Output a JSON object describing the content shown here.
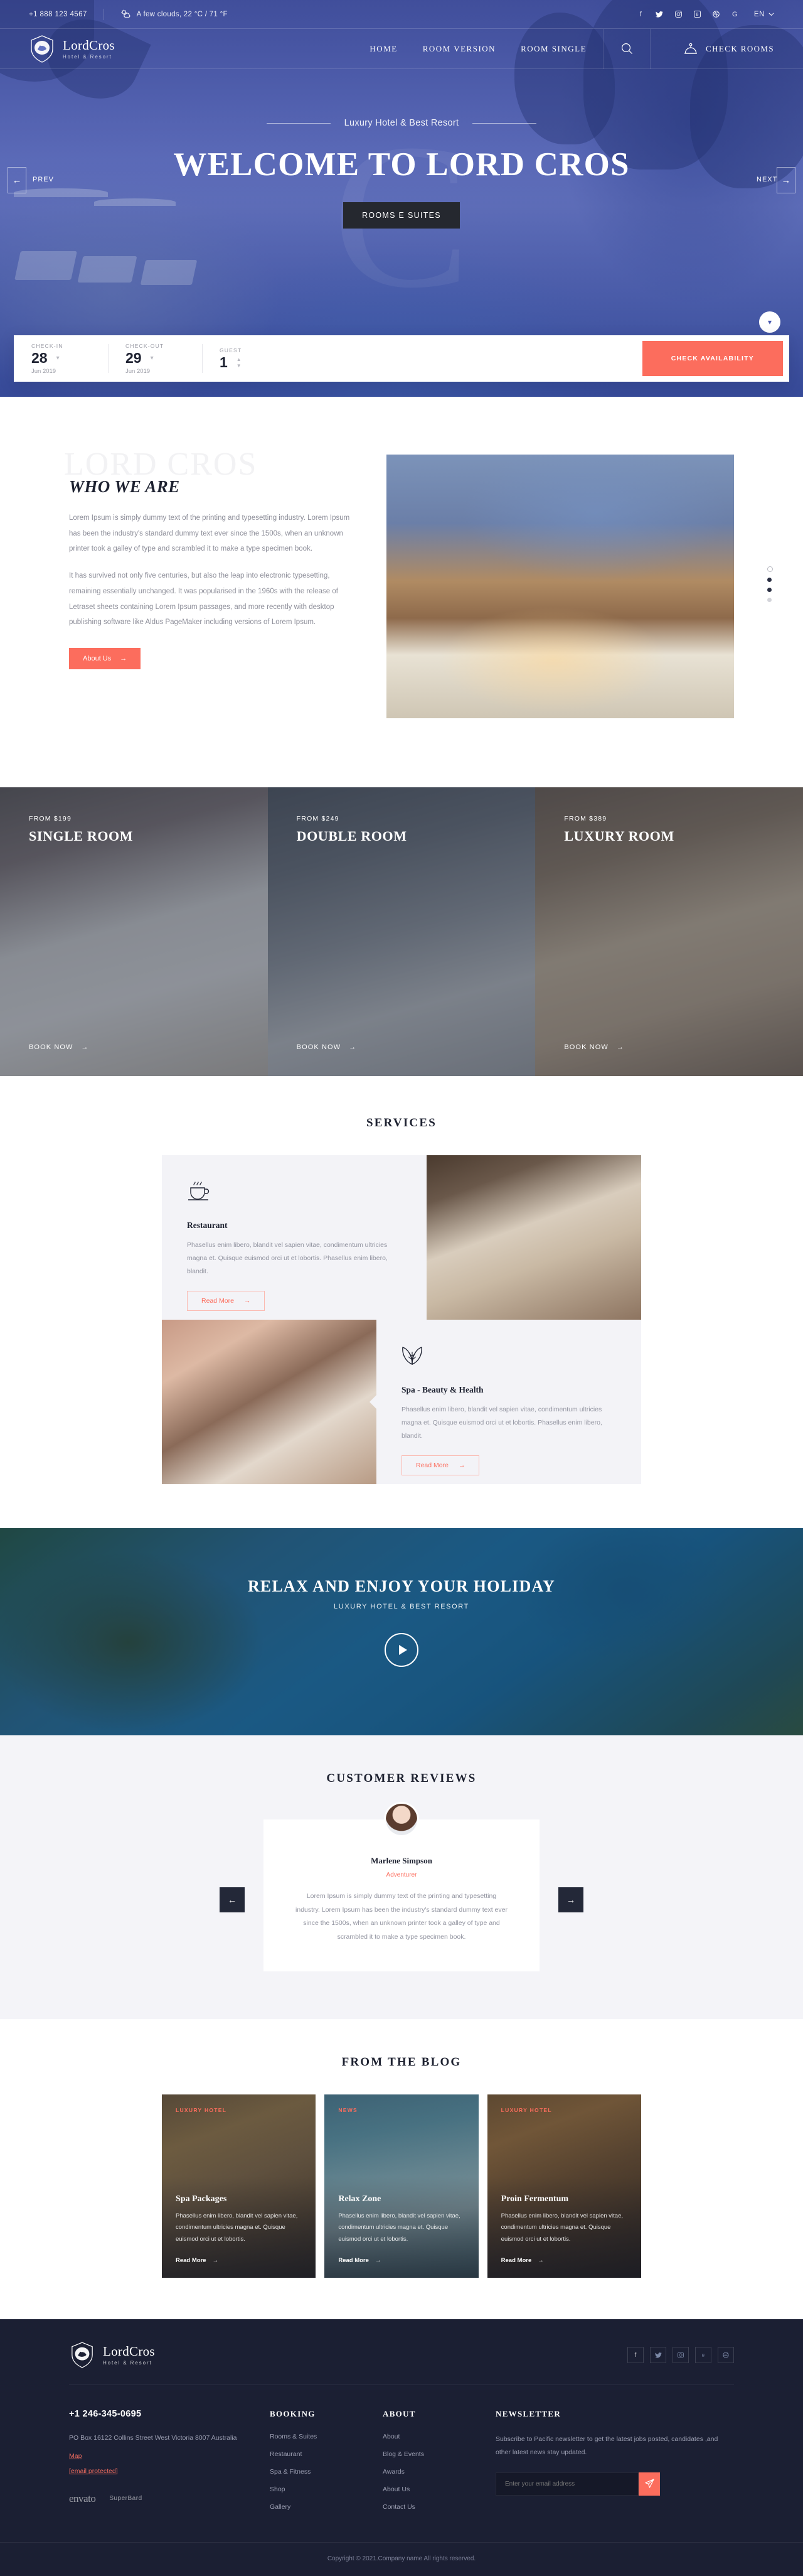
{
  "topbar": {
    "phone": "+1 888 123 4567",
    "weather": "A few clouds, 22 °C / 71 °F",
    "weather_icon": "cloud-sun-icon",
    "socials": [
      {
        "name": "facebook-icon",
        "glyph": "f"
      },
      {
        "name": "twitter-icon",
        "glyph": "ᴛ"
      },
      {
        "name": "instagram-icon",
        "glyph": "◎"
      },
      {
        "name": "behance-icon",
        "glyph": "Ⓑ"
      },
      {
        "name": "dribbble-icon",
        "glyph": "◉"
      },
      {
        "name": "google-icon",
        "glyph": "G"
      }
    ],
    "lang": "EN"
  },
  "brand": {
    "name": "LordCros",
    "tagline": "Hotel & Resort",
    "logo_icon": "lion-crest-icon"
  },
  "nav": {
    "items": [
      {
        "label": "HOME"
      },
      {
        "label": "ROOM VERSION"
      },
      {
        "label": "ROOM SINGLE"
      }
    ],
    "search_icon": "search-icon",
    "bell_icon": "service-bell-icon",
    "check_rooms": "CHECK ROOMS"
  },
  "hero": {
    "kicker": "Luxury Hotel & Best Resort",
    "title": "WELCOME TO LORD CROS",
    "button": "ROOMS E SUITES",
    "prev_label": "PREV",
    "next_label": "NEXT",
    "scroll_label": "Scroll Down",
    "watermark": "C"
  },
  "booking": {
    "checkin": {
      "label": "CHECK-IN",
      "day": "28",
      "month": "Jun 2019"
    },
    "checkout": {
      "label": "CHECK-OUT",
      "day": "29",
      "month": "Jun 2019"
    },
    "guest": {
      "label": "GUEST",
      "count": "1"
    },
    "submit": "CHECK AVAILABILITY"
  },
  "about": {
    "ghost": "LORD CROS",
    "heading": "WHO WE ARE",
    "p1": "Lorem Ipsum is simply dummy text of the printing and typesetting industry. Lorem Ipsum has been the industry's standard dummy text ever since the 1500s, when an unknown printer took a galley of type and scrambled it to make a type specimen book.",
    "p2": "It has survived not only five centuries, but also the leap into electronic typesetting, remaining essentially unchanged. It was popularised in the 1960s with the release of Letraset sheets containing Lorem Ipsum passages, and more recently with desktop publishing software like Aldus PageMaker including versions of Lorem Ipsum.",
    "button": "About Us"
  },
  "rooms": [
    {
      "from": "FROM $199",
      "name": "SINGLE ROOM",
      "cta": "BOOK NOW"
    },
    {
      "from": "FROM $249",
      "name": "DOUBLE ROOM",
      "cta": "BOOK NOW"
    },
    {
      "from": "FROM $389",
      "name": "LUXURY ROOM",
      "cta": "BOOK NOW"
    }
  ],
  "services": {
    "title": "SERVICES",
    "cards": [
      {
        "icon": "coffee-cup-icon",
        "heading": "Restaurant",
        "text": "Phasellus enim libero, blandit vel sapien vitae, condimentum ultricies magna et. Quisque euismod orci ut et lobortis. Phasellus enim libero, blandit.",
        "cta": "Read More"
      },
      {
        "icon": "leaves-icon",
        "heading": "Spa - Beauty & Health",
        "text": "Phasellus enim libero, blandit vel sapien vitae, condimentum ultricies magna et. Quisque euismod orci ut et lobortis. Phasellus enim libero, blandit.",
        "cta": "Read More"
      }
    ]
  },
  "relax": {
    "heading": "RELAX AND ENJOY YOUR HOLIDAY",
    "sub": "LUXURY HOTEL & BEST RESORT",
    "play_icon": "play-icon"
  },
  "reviews": {
    "title": "CUSTOMER REVIEWS",
    "avatar_icon": "avatar-icon",
    "name": "Marlene Simpson",
    "role": "Adventurer",
    "text": "Lorem Ipsum is simply dummy text of the printing and typesetting industry. Lorem Ipsum has been the industry's standard dummy text ever since the 1500s, when an unknown printer took a galley of type and scrambled it to make a type specimen book.",
    "prev_icon": "arrow-left-icon",
    "next_icon": "arrow-right-icon"
  },
  "blog": {
    "title": "FROM THE BLOG",
    "posts": [
      {
        "tag": "LUXURY HOTEL",
        "heading": "Spa Packages",
        "text": "Phasellus enim libero, blandit vel sapien vitae, condimentum ultricies magna et. Quisque euismod orci ut et lobortis.",
        "cta": "Read More"
      },
      {
        "tag": "NEWS",
        "heading": "Relax Zone",
        "text": "Phasellus enim libero, blandit vel sapien vitae, condimentum ultricies magna et. Quisque euismod orci ut et lobortis.",
        "cta": "Read More"
      },
      {
        "tag": "LUXURY HOTEL",
        "heading": "Proin Fermentum",
        "text": "Phasellus enim libero, blandit vel sapien vitae, condimentum ultricies magna et. Quisque euismod orci ut et lobortis.",
        "cta": "Read More"
      }
    ]
  },
  "footer": {
    "socials": [
      {
        "name": "facebook-icon",
        "glyph": "f"
      },
      {
        "name": "twitter-icon",
        "glyph": "ᴛ"
      },
      {
        "name": "instagram-icon",
        "glyph": "◎"
      },
      {
        "name": "behance-icon",
        "glyph": "Ⓑ"
      },
      {
        "name": "dribbble-icon",
        "glyph": "◉"
      }
    ],
    "phone": "+1 246-345-0695",
    "address": "PO Box 16122 Collins Street West Victoria 8007 Australia",
    "map_link": "Map",
    "email_link": "[email protected]",
    "partner_a": "envato",
    "partner_b": "SuperBard",
    "booking": {
      "title": "BOOKING",
      "items": [
        "Rooms & Suites",
        "Restaurant",
        "Spa & Fitness",
        "Shop",
        "Gallery"
      ]
    },
    "about": {
      "title": "ABOUT",
      "items": [
        "About",
        "Blog & Events",
        "Awards",
        "About Us",
        "Contact Us"
      ]
    },
    "newsletter": {
      "title": "NEWSLETTER",
      "text": "Subscribe to Pacific newsletter to get the latest jobs posted, candidates ,and other latest news stay updated.",
      "placeholder": "Enter your email address",
      "send_icon": "send-icon"
    },
    "copyright": "Copyright © 2021.Company name All rights reserved."
  },
  "colors": {
    "accent": "#fc6d5d",
    "dark": "#1b1f33",
    "hero_blue": "#5d6dbe"
  }
}
